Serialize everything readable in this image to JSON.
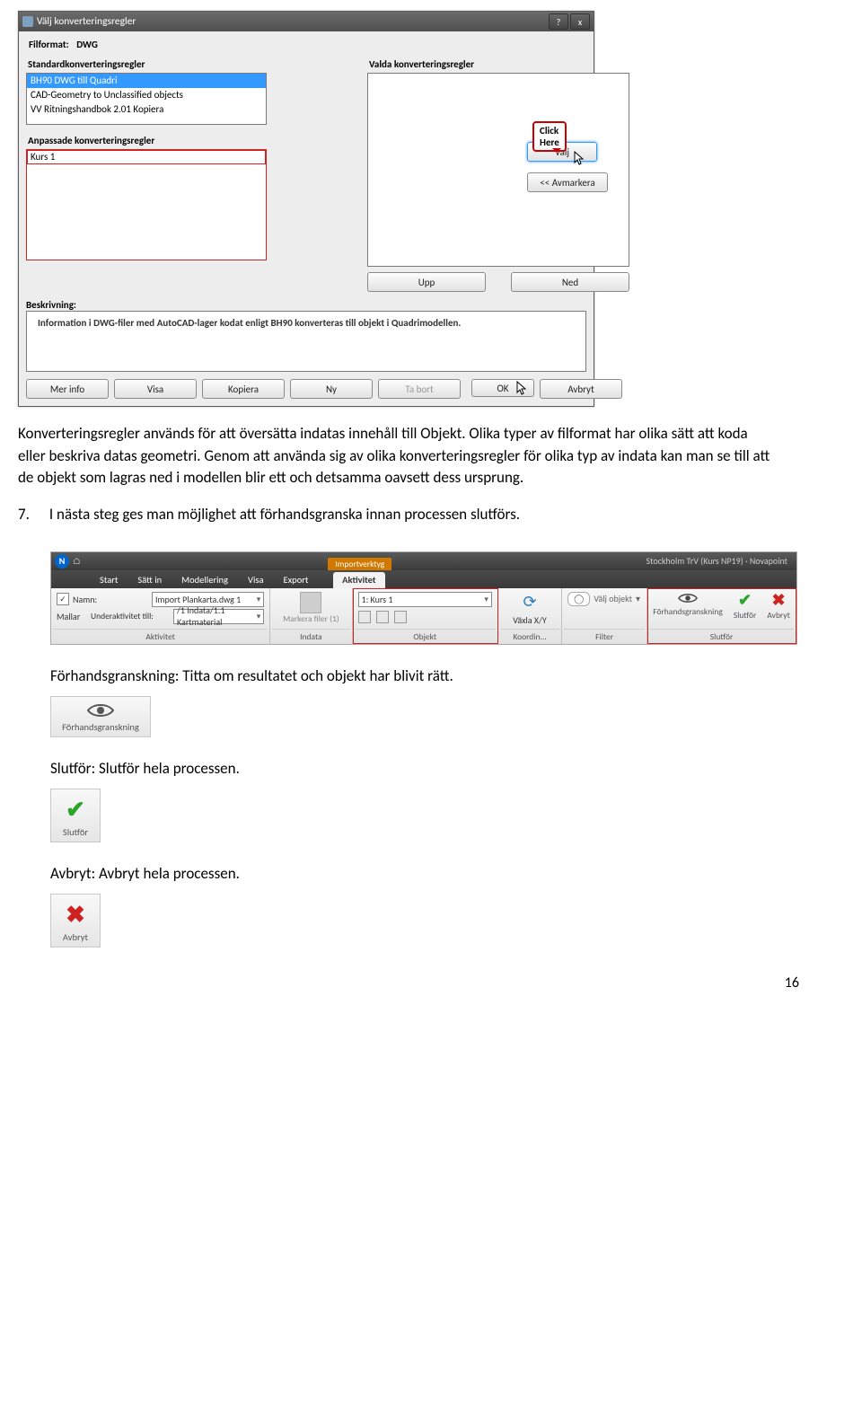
{
  "dialog": {
    "title": "Välj konverteringsregler",
    "help_btn": "?",
    "close_btn": "x",
    "filformat_label": "Filformat:",
    "filformat_value": "DWG",
    "std_label": "Standardkonverteringsregler",
    "valda_label": "Valda konverteringsregler",
    "std_items": [
      "BH90 DWG till Quadri",
      "CAD-Geometry to Unclassified objects",
      "VV Ritningshandbok 2.01 Kopiera"
    ],
    "anpassade_label": "Anpassade konverteringsregler",
    "anpassade_items": [
      "Kurs 1"
    ],
    "callout": "Click Here",
    "valj_btn": "Välj",
    "avmarkera_btn": "<< Avmarkera",
    "upp_btn": "Upp",
    "ned_btn": "Ned",
    "beskr_label": "Beskrivning:",
    "beskr_text": "Information i DWG-filer med AutoCAD-lager kodat enligt BH90 konverteras till objekt i Quadrimodellen.",
    "footer": {
      "merinfo": "Mer info",
      "visa": "Visa",
      "kopiera": "Kopiera",
      "ny": "Ny",
      "tabort": "Ta bort",
      "ok": "OK",
      "avbryt": "Avbryt"
    }
  },
  "para1": "Konverteringsregler används för att översätta indatas innehåll till Objekt. Olika typer av filformat har olika sätt att koda eller beskriva datas geometri. Genom att använda sig av olika konverteringsregler för olika typ av indata kan man se till att de objekt som lagras ned i modellen blir ett och detsamma oavsett dess ursprung.",
  "step7_num": "7.",
  "step7_text": "I nästa steg ges man möjlighet att förhandsgranska innan processen slutförs.",
  "ribbon": {
    "titlebar_right": "Stockholm TrV (Kurs NP19) · Novapoint",
    "context_sup": "Importverktyg",
    "tabs": [
      "Start",
      "Sätt in",
      "Modellering",
      "Visa",
      "Export"
    ],
    "active_tab": "Aktivitet",
    "activity": {
      "group_label": "Aktivitet",
      "namn_label": "Namn:",
      "namn_value": "Import Plankarta.dwg 1",
      "mallar_label": "Mallar",
      "under_label": "Underaktivitet till:",
      "under_value": "/1 Indata/1.1 Kartmaterial"
    },
    "indata": {
      "group_label": "Indata",
      "mark_label": "Markera filer (1)"
    },
    "objekt": {
      "group_label": "Objekt",
      "value": "1: Kurs 1"
    },
    "koord": {
      "group_label": "Koordin...",
      "label": "Växla X/Y"
    },
    "filter": {
      "group_label": "Filter",
      "label": "Välj objekt"
    },
    "slutfor": {
      "group_label": "Slutför",
      "forh": "Förhandsgranskning",
      "slut": "Slutför",
      "avbr": "Avbryt"
    }
  },
  "forh_line": "Förhandsgranskning: Titta om resultatet och objekt har blivit rätt.",
  "forh_btn": "Förhandsgranskning",
  "slut_line": "Slutför: Slutför hela processen.",
  "slut_btn": "Slutför",
  "avbr_line": "Avbryt: Avbryt hela processen.",
  "avbr_btn": "Avbryt",
  "page_no": "16"
}
